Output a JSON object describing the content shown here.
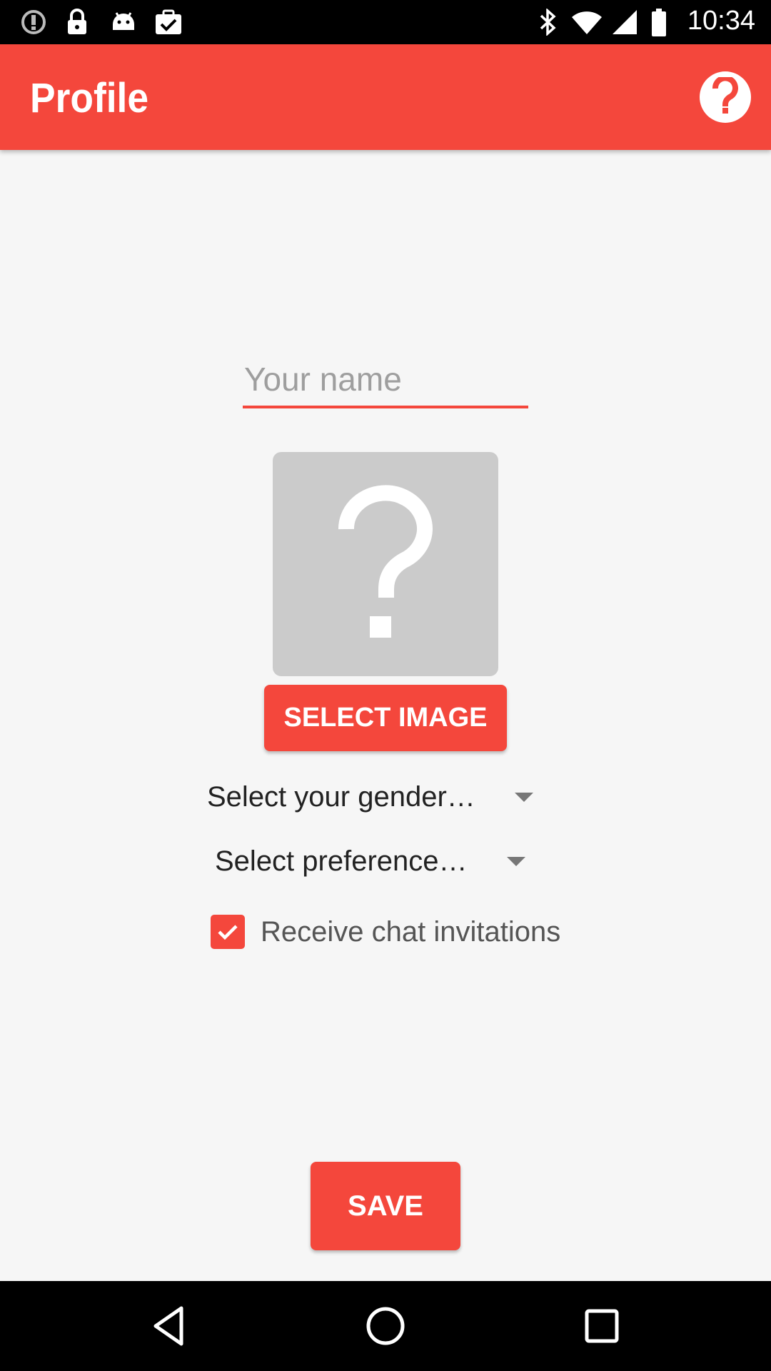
{
  "status_bar": {
    "time": "10:34",
    "left_icons": [
      "alert-circle-icon",
      "lock-icon",
      "android-icon",
      "clipboard-check-icon"
    ],
    "right_icons": [
      "bluetooth-icon",
      "wifi-icon",
      "signal-icon",
      "battery-icon"
    ]
  },
  "app_bar": {
    "title": "Profile",
    "help_icon": "help-icon"
  },
  "form": {
    "name_placeholder": "Your name",
    "name_value": "",
    "image_placeholder_icon": "question-mark-icon",
    "select_image_label": "SELECT IMAGE",
    "gender_spinner": "Select your gender…",
    "preference_spinner": "Select preference…",
    "chat_invitations_label": "Receive chat invitations",
    "chat_invitations_checked": true,
    "save_label": "SAVE"
  },
  "nav_bar": {
    "icons": [
      "back-icon",
      "home-icon",
      "recents-icon"
    ]
  },
  "colors": {
    "accent": "#f4473c",
    "background": "#f6f6f6",
    "image_placeholder": "#cbcbcb"
  }
}
